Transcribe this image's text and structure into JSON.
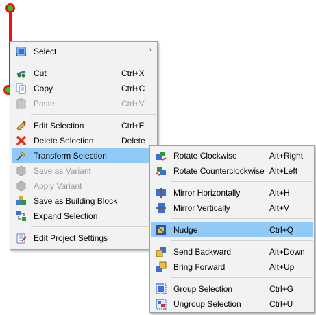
{
  "context_menu": {
    "items": [
      {
        "label": "Select",
        "shortcut": "",
        "submenu": true,
        "disabled": false,
        "icon": "select-icon"
      },
      {
        "label": "Cut",
        "shortcut": "Ctrl+X",
        "submenu": false,
        "disabled": false,
        "icon": "cut-icon"
      },
      {
        "label": "Copy",
        "shortcut": "Ctrl+C",
        "submenu": false,
        "disabled": false,
        "icon": "copy-icon"
      },
      {
        "label": "Paste",
        "shortcut": "Ctrl+V",
        "submenu": false,
        "disabled": true,
        "icon": "paste-icon"
      },
      {
        "label": "Edit Selection",
        "shortcut": "Ctrl+E",
        "submenu": false,
        "disabled": false,
        "icon": "edit-selection-icon"
      },
      {
        "label": "Delete Selection",
        "shortcut": "Delete",
        "submenu": false,
        "disabled": false,
        "icon": "delete-icon"
      },
      {
        "label": "Transform Selection",
        "shortcut": "",
        "submenu": true,
        "disabled": false,
        "icon": "transform-icon",
        "highlighted": true
      },
      {
        "label": "Save as Variant",
        "shortcut": "",
        "submenu": false,
        "disabled": true,
        "icon": "save-variant-icon"
      },
      {
        "label": "Apply Variant",
        "shortcut": "",
        "submenu": true,
        "disabled": true,
        "icon": "apply-variant-icon"
      },
      {
        "label": "Save as Building Block",
        "shortcut": "",
        "submenu": false,
        "disabled": false,
        "icon": "building-block-icon"
      },
      {
        "label": "Expand Selection",
        "shortcut": "",
        "submenu": true,
        "disabled": false,
        "icon": "expand-selection-icon"
      },
      {
        "label": "Edit Project Settings",
        "shortcut": "",
        "submenu": false,
        "disabled": false,
        "icon": "project-settings-icon"
      }
    ]
  },
  "transform_submenu": {
    "items": [
      {
        "label": "Rotate Clockwise",
        "shortcut": "Alt+Right",
        "icon": "rotate-clockwise-icon"
      },
      {
        "label": "Rotate Counterclockwise",
        "shortcut": "Alt+Left",
        "icon": "rotate-counterclockwise-icon"
      },
      {
        "label": "Mirror Horizontally",
        "shortcut": "Alt+H",
        "icon": "mirror-horizontal-icon"
      },
      {
        "label": "Mirror Vertically",
        "shortcut": "Alt+V",
        "icon": "mirror-vertical-icon"
      },
      {
        "label": "Nudge",
        "shortcut": "Ctrl+Q",
        "icon": "nudge-icon",
        "highlighted": true
      },
      {
        "label": "Send Backward",
        "shortcut": "Alt+Down",
        "icon": "send-backward-icon"
      },
      {
        "label": "Bring Forward",
        "shortcut": "Alt+Up",
        "icon": "bring-forward-icon"
      },
      {
        "label": "Group Selection",
        "shortcut": "Ctrl+G",
        "icon": "group-selection-icon"
      },
      {
        "label": "Ungroup Selection",
        "shortcut": "Ctrl+U",
        "icon": "ungroup-selection-icon"
      }
    ]
  },
  "colors": {
    "highlight": "#91c9f7",
    "wire": "#ee1111",
    "node": "#22cc22",
    "menu_bg": "#f2f2f2"
  }
}
